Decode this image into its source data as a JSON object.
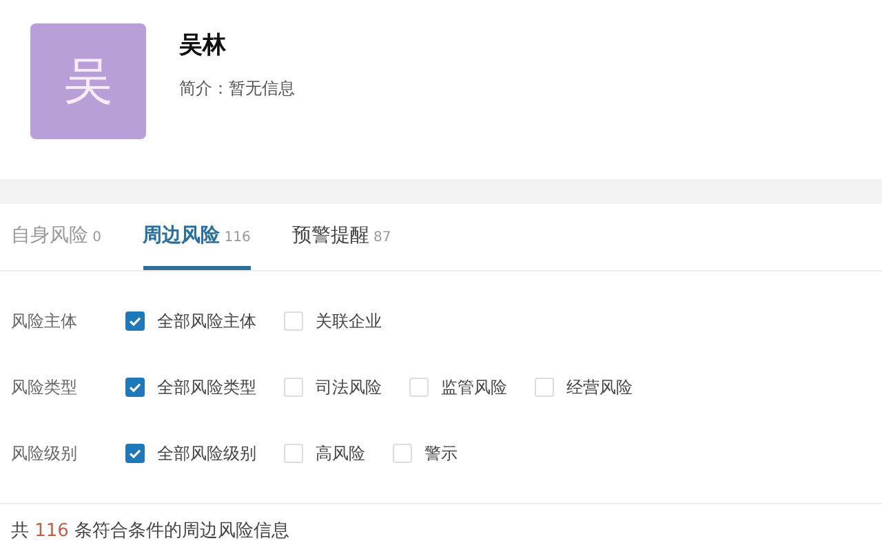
{
  "profile": {
    "avatar_initial": "吴",
    "name": "吴林",
    "intro": "简介：暂无信息"
  },
  "tabs": [
    {
      "label": "自身风险",
      "count": "0",
      "selected": false
    },
    {
      "label": "周边风险",
      "count": "116",
      "selected": true
    },
    {
      "label": "预警提醒",
      "count": "87",
      "selected": false
    }
  ],
  "filters": [
    {
      "label": "风险主体",
      "options": [
        {
          "label": "全部风险主体",
          "checked": true
        },
        {
          "label": "关联企业",
          "checked": false
        }
      ]
    },
    {
      "label": "风险类型",
      "options": [
        {
          "label": "全部风险类型",
          "checked": true
        },
        {
          "label": "司法风险",
          "checked": false
        },
        {
          "label": "监管风险",
          "checked": false
        },
        {
          "label": "经营风险",
          "checked": false
        }
      ]
    },
    {
      "label": "风险级别",
      "options": [
        {
          "label": "全部风险级别",
          "checked": true
        },
        {
          "label": "高风险",
          "checked": false
        },
        {
          "label": "警示",
          "checked": false
        }
      ]
    }
  ],
  "summary": {
    "prefix": "共",
    "count": "116",
    "suffix": "条符合条件的周边风险信息"
  }
}
